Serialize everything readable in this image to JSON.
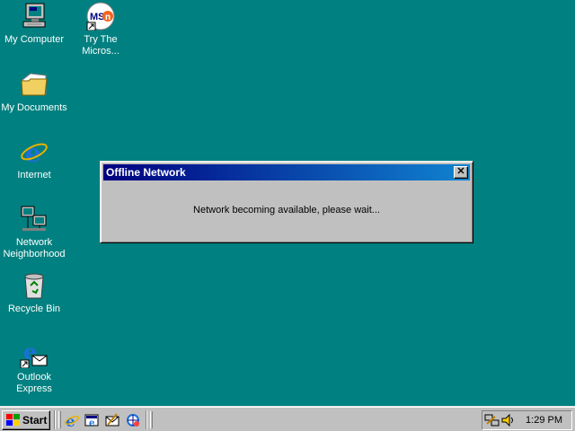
{
  "desktop": {
    "icons": [
      {
        "label": "My Computer",
        "icon": "my-computer-icon"
      },
      {
        "label": "Try The Micros...",
        "icon": "msn-icon"
      },
      {
        "label": "My Documents",
        "icon": "folder-icon"
      },
      {
        "label": "Internet",
        "icon": "internet-explorer-icon"
      },
      {
        "label": "Network Neighborhood",
        "icon": "network-icon"
      },
      {
        "label": "Recycle Bin",
        "icon": "recycle-bin-icon"
      },
      {
        "label": "Outlook Express",
        "icon": "outlook-express-icon"
      }
    ],
    "background_color": "#008080"
  },
  "dialog": {
    "title": "Offline Network",
    "message": "Network becoming available, please wait...",
    "close_label": "✕"
  },
  "taskbar": {
    "start_label": "Start",
    "quick_launch": [
      "ie-icon",
      "show-desktop-icon",
      "outlook-express-icon",
      "channels-icon"
    ],
    "tray_icons": [
      "network-tray-icon",
      "volume-icon"
    ],
    "clock": "1:29 PM"
  }
}
